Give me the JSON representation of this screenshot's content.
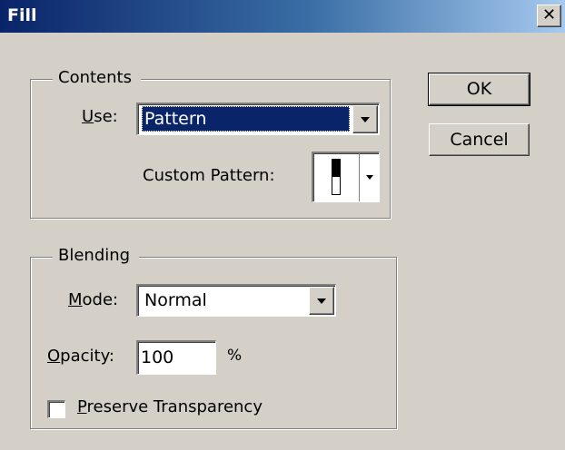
{
  "window": {
    "title": "Fill",
    "close_glyph": "✕"
  },
  "buttons": {
    "ok": "OK",
    "cancel": "Cancel"
  },
  "contents": {
    "legend": "Contents",
    "use_label_accel": "U",
    "use_label_rest": "se:",
    "use_value": "Pattern",
    "custom_pattern_label": "Custom Pattern:",
    "pattern_icon": "pattern-swatch-icon"
  },
  "blending": {
    "legend": "Blending",
    "mode_label_accel": "M",
    "mode_label_rest": "ode:",
    "mode_value": "Normal",
    "opacity_label_accel": "O",
    "opacity_label_rest": "pacity:",
    "opacity_value": "100",
    "opacity_unit": "%",
    "preserve_accel": "P",
    "preserve_rest": "reserve Transparency",
    "preserve_checked": false
  },
  "colors": {
    "titlebar_start": "#0a246a",
    "titlebar_end": "#a6caf0",
    "face": "#d4d0c8",
    "selection": "#0a246a"
  }
}
